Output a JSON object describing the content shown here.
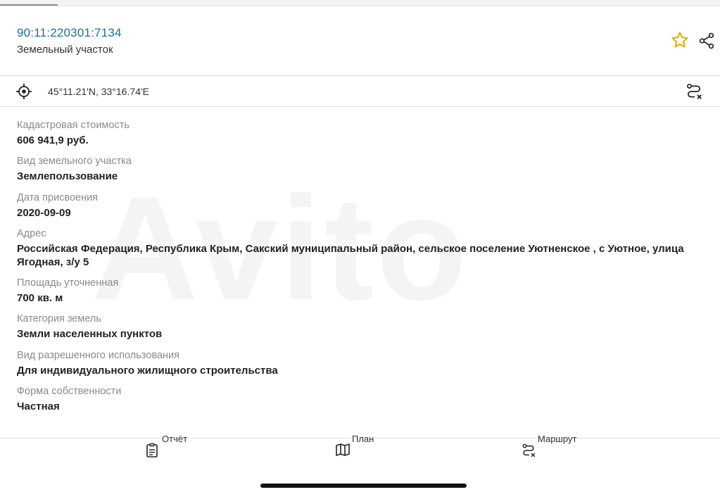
{
  "header": {
    "cadastral_number": "90:11:220301:7134",
    "object_type": "Земельный участок"
  },
  "location": {
    "coordinates": "45°11.21'N, 33°16.74'E"
  },
  "watermark": "Avito",
  "fields": [
    {
      "label": "Кадастровая стоимость",
      "value": "606 941,9 руб."
    },
    {
      "label": "Вид земельного участка",
      "value": "Землепользование"
    },
    {
      "label": "Дата присвоения",
      "value": "2020-09-09"
    },
    {
      "label": "Адрес",
      "value": "Российская Федерация, Республика Крым, Сакский муниципальный район, сельское поселение Уютненское , с Уютное, улица Ягодная, з/у 5"
    },
    {
      "label": "Площадь уточненная",
      "value": "700 кв. м"
    },
    {
      "label": "Категория земель",
      "value": "Земли населенных пунктов"
    },
    {
      "label": "Вид разрешенного использования",
      "value": "Для индивидуального жилищного строительства"
    },
    {
      "label": "Форма собственности",
      "value": "Частная"
    }
  ],
  "bottom_tabs": [
    {
      "label": "Отчёт",
      "icon": "report-icon"
    },
    {
      "label": "План",
      "icon": "map-icon"
    },
    {
      "label": "Маршрут",
      "icon": "route-icon"
    }
  ],
  "colors": {
    "accent_link": "#1a6fa0",
    "star": "#e0b400"
  }
}
